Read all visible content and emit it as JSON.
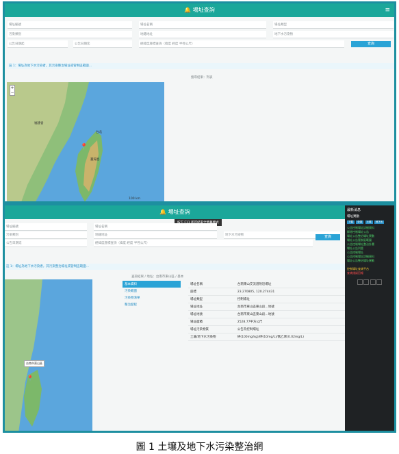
{
  "app": {
    "title": "🔔 場址查詢",
    "menu_icon": "menu-icon"
  },
  "form_top": {
    "fields": [
      "場址編號",
      "場址名稱",
      "場址類型",
      "污染類別",
      "地籍地址",
      "地下水污染物",
      "公告日期起",
      "公告日期迄",
      "經緯度座標查詢（緯度 經度 半徑公尺）"
    ],
    "search_label": "查詢"
  },
  "notice_top": "註 1：場址為地下水污染者，其污染整治場址或管制區範圍...",
  "map_section_label": "搜尋結果：列表",
  "map_labels": {
    "province": "福建省",
    "taiwan": "臺灣島",
    "city": "台北",
    "scale": "100 km"
  },
  "panel2": {
    "tooltip": "按下 F11 即可結束全螢幕模式",
    "breadcrumb": "查詢結果 / 地址：台南市東山區 / 基本",
    "nav": [
      "基本資料",
      "污染範圍",
      "污染物清單",
      "整治歷程"
    ],
    "table": [
      {
        "k": "場址名稱",
        "v": "台南東山交流道附近場址"
      },
      {
        "k": "座標",
        "v": "23.270805, 120.274431"
      },
      {
        "k": "場址類型",
        "v": "控制場址"
      },
      {
        "k": "場址地址",
        "v": "台南市東山區東山段…地號"
      },
      {
        "k": "場址地號",
        "v": "台南市東山區東山段…地號"
      },
      {
        "k": "場址面積",
        "v": "2528.77平方公尺"
      },
      {
        "k": "場址污染物質",
        "v": "公告為控制場址"
      },
      {
        "k": "土壤/地下水污染物",
        "v": "砷(100mg/kg)/砷(10mg/L)/氯乙烯(0.02mg/L)"
      }
    ],
    "map_popup": "台南市東山區",
    "sidebar": {
      "title": "最新消息",
      "heading": "場址異動",
      "tabs": [
        "下載",
        "全部",
        "土壤",
        "地下水"
      ],
      "items": [
        "公告控制場址詳細資料",
        "解除控制場址公告",
        "場址公告整治場址異動",
        "場址公告管制區範圍",
        "公告控制場址整治計畫",
        "場址公告列管",
        "公告控制場址",
        "公告控制場址詳細資料",
        "場址公告整治場址異動"
      ],
      "footer_ok": "控制場址查詢平台",
      "footer_err": "查詢錯誤回報"
    }
  },
  "caption": "圖 1  土壤及地下水污染整治網"
}
